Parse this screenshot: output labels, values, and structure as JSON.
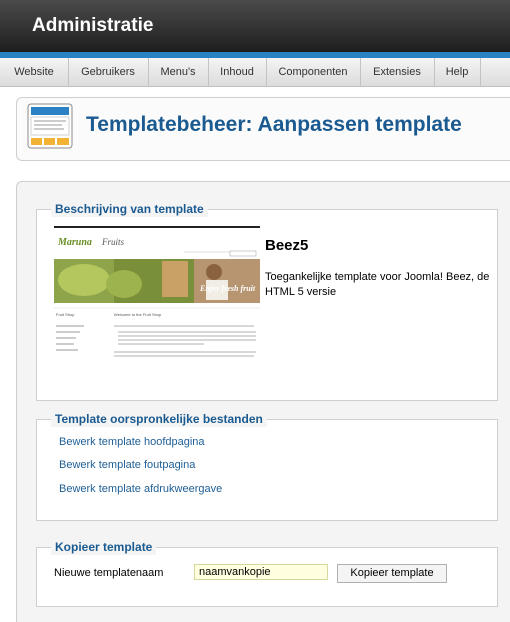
{
  "app": {
    "title": "Administratie"
  },
  "menu": [
    "Website",
    "Gebruikers",
    "Menu's",
    "Inhoud",
    "Componenten",
    "Extensies",
    "Help"
  ],
  "page": {
    "title": "Templatebeheer: Aanpassen template"
  },
  "description": {
    "legend": "Beschrijving van template",
    "template_name": "Beez5",
    "template_description": "Toegankelijke template voor Joomla! Beez, de HTML 5 versie",
    "preview": {
      "logo": "Maruna",
      "logo_suffix": "Fruits",
      "banner_text": "Enjoy fresh fruit",
      "nav_item": "Fruit Shop",
      "welcome": "Welcome to the Fruit Shop"
    }
  },
  "files": {
    "legend": "Template oorspronkelijke bestanden",
    "links": [
      "Bewerk template hoofdpagina",
      "Bewerk template foutpagina",
      "Bewerk template afdrukweergave"
    ]
  },
  "copy": {
    "legend": "Kopieer template",
    "label": "Nieuwe templatenaam",
    "input_value": "naamvankopie",
    "button_label": "Kopieer template"
  }
}
